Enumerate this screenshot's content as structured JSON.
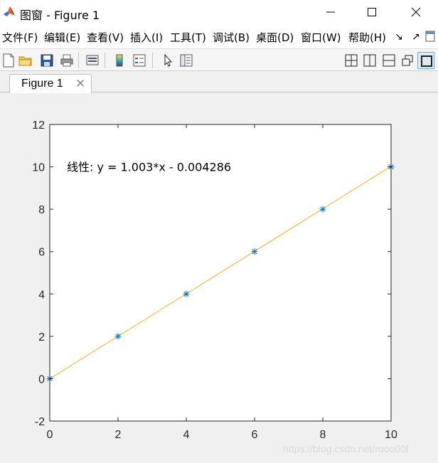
{
  "window": {
    "title": "图窗 - Figure 1",
    "icon": "matlab-logo-icon"
  },
  "menu": [
    {
      "label": "文件(F)"
    },
    {
      "label": "编辑(E)"
    },
    {
      "label": "查看(V)"
    },
    {
      "label": "插入(I)"
    },
    {
      "label": "工具(T)"
    },
    {
      "label": "调试(B)"
    },
    {
      "label": "桌面(D)"
    },
    {
      "label": "窗口(W)"
    },
    {
      "label": "帮助(H)"
    }
  ],
  "menu_extra": {
    "dock_arrow": "↘",
    "undock_arrow": "↗"
  },
  "toolbar": {
    "left_icons": [
      "new-figure-icon",
      "open-file-icon",
      "save-icon",
      "print-icon",
      "link-plot-icon",
      "insert-colorbar-icon",
      "insert-legend-icon",
      "pointer-icon",
      "property-inspector-icon"
    ],
    "right_icons": [
      "tile-grid-icon",
      "split-vertical-icon",
      "split-horizontal-icon",
      "float-window-icon",
      "maximize-pane-icon"
    ]
  },
  "tab": {
    "label": "Figure 1",
    "close_glyph": "✕"
  },
  "chart_data": {
    "type": "line",
    "title": "",
    "xlabel": "",
    "ylabel": "",
    "xlim": [
      0,
      10
    ],
    "ylim": [
      -2,
      12
    ],
    "xticks": [
      0,
      2,
      4,
      6,
      8,
      10
    ],
    "yticks": [
      -2,
      0,
      2,
      4,
      6,
      8,
      10,
      12
    ],
    "grid": false,
    "series": [
      {
        "style": "markers",
        "marker": "*",
        "color": "#0072bd",
        "x": [
          0,
          2,
          4,
          6,
          8,
          10
        ],
        "y": [
          0,
          2,
          4,
          6,
          8,
          10
        ]
      },
      {
        "style": "line",
        "color": "#edb120",
        "x": [
          0,
          10
        ],
        "y": [
          -0.004286,
          10.025714
        ]
      }
    ],
    "annotation": {
      "text": "线性:  y = 1.003*x - 0.004286",
      "x": 0.5,
      "y": 10
    }
  },
  "watermark": "https://blog.csdn.net/rooo00f"
}
